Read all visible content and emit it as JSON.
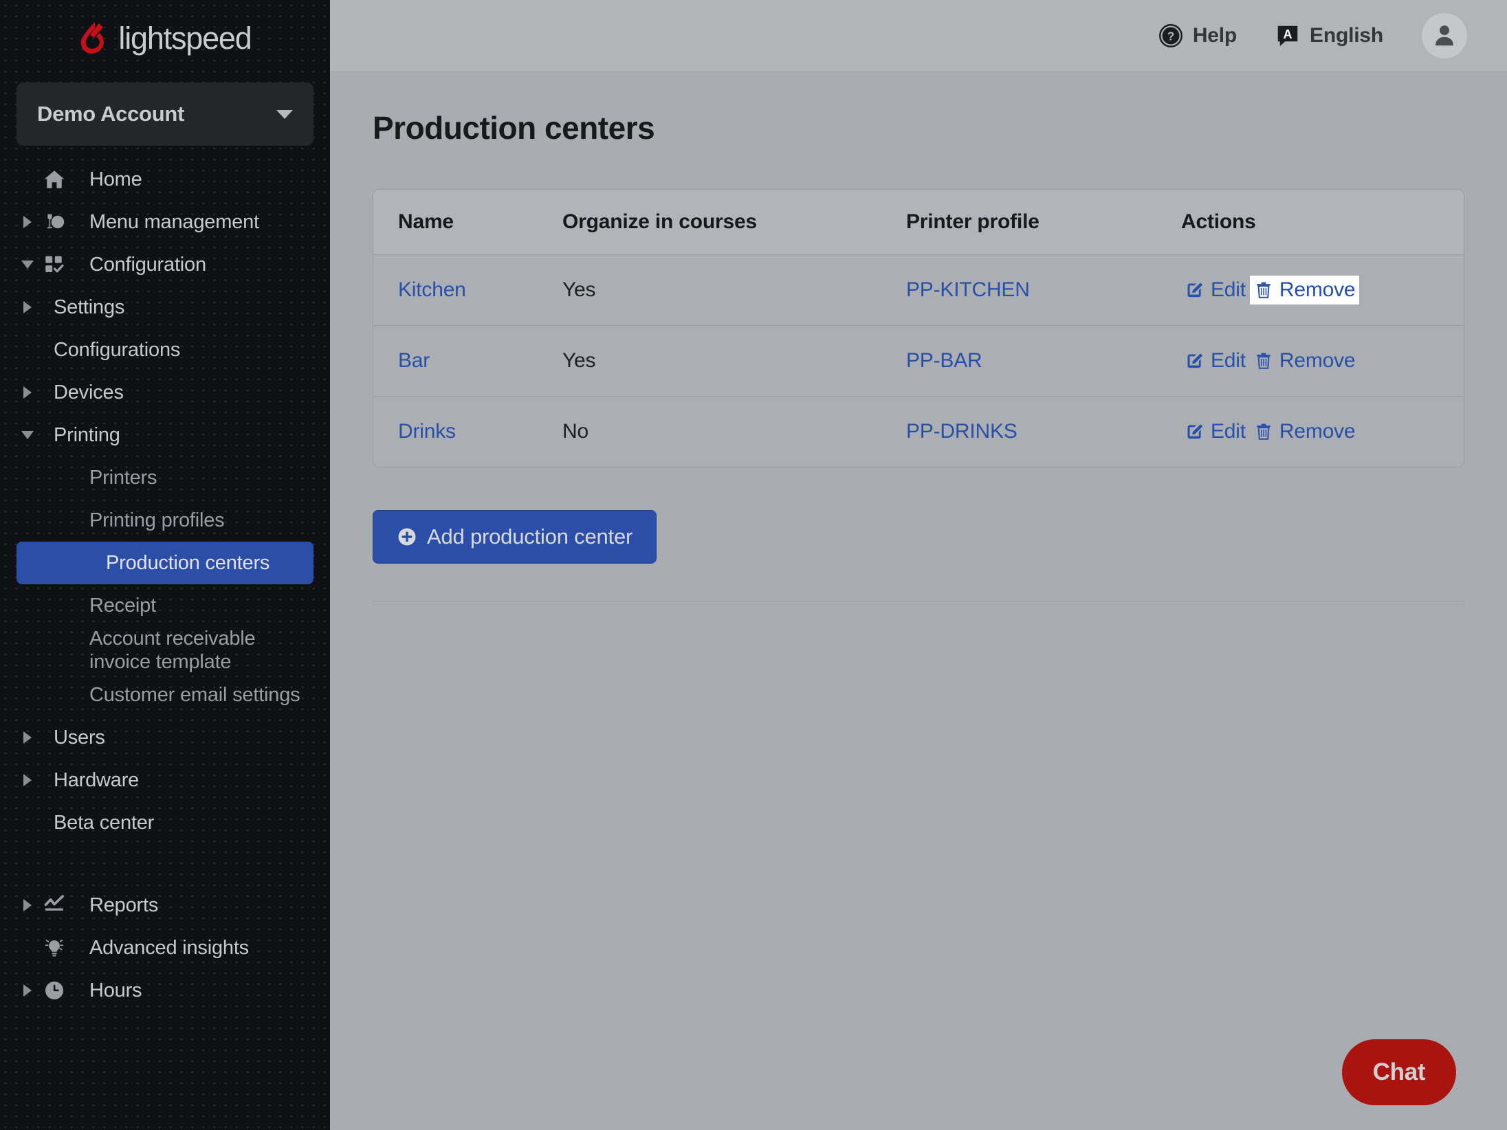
{
  "brand": {
    "name": "lightspeed",
    "logo_color": "#c3101a",
    "accent_blue": "#2b4fa8",
    "link_blue": "#2850a7",
    "chat_red": "#aa1410"
  },
  "sidebar": {
    "account": {
      "label": "Demo Account",
      "caret": "chevron-down-icon"
    },
    "items": [
      {
        "label": "Home",
        "level": 1,
        "icon": "home-icon",
        "arrow": "none",
        "active": false,
        "dim": false
      },
      {
        "label": "Menu management",
        "level": 1,
        "icon": "menu-mgmt-icon",
        "arrow": "right",
        "active": false,
        "dim": false
      },
      {
        "label": "Configuration",
        "level": 1,
        "icon": "config-icon",
        "arrow": "open",
        "active": false,
        "dim": false
      },
      {
        "label": "Settings",
        "level": 2,
        "icon": "none",
        "arrow": "right",
        "active": false,
        "dim": false
      },
      {
        "label": "Configurations",
        "level": 2,
        "icon": "none",
        "arrow": "none",
        "active": false,
        "dim": false
      },
      {
        "label": "Devices",
        "level": 2,
        "icon": "none",
        "arrow": "right",
        "active": false,
        "dim": false
      },
      {
        "label": "Printing",
        "level": 2,
        "icon": "none",
        "arrow": "open",
        "active": false,
        "dim": false
      },
      {
        "label": "Printers",
        "level": 3,
        "icon": "none",
        "arrow": "none",
        "active": false,
        "dim": true
      },
      {
        "label": "Printing profiles",
        "level": 3,
        "icon": "none",
        "arrow": "none",
        "active": false,
        "dim": true
      },
      {
        "label": "Production centers",
        "level": 3,
        "icon": "none",
        "arrow": "none",
        "active": true,
        "dim": false
      },
      {
        "label": "Receipt",
        "level": 3,
        "icon": "none",
        "arrow": "none",
        "active": false,
        "dim": true
      },
      {
        "label": "Account receivable invoice template",
        "level": 3,
        "icon": "none",
        "arrow": "none",
        "active": false,
        "dim": true
      },
      {
        "label": "Customer email settings",
        "level": 3,
        "icon": "none",
        "arrow": "none",
        "active": false,
        "dim": true
      },
      {
        "label": "Users",
        "level": 2,
        "icon": "none",
        "arrow": "right",
        "active": false,
        "dim": false
      },
      {
        "label": "Hardware",
        "level": 2,
        "icon": "none",
        "arrow": "right",
        "active": false,
        "dim": false
      },
      {
        "label": "Beta center",
        "level": 2,
        "icon": "none",
        "arrow": "none",
        "active": false,
        "dim": false
      }
    ],
    "items_bottom": [
      {
        "label": "Reports",
        "level": 1,
        "icon": "reports-icon",
        "arrow": "right",
        "active": false,
        "dim": false
      },
      {
        "label": "Advanced insights",
        "level": 1,
        "icon": "lightbulb-icon",
        "arrow": "none",
        "active": false,
        "dim": false
      },
      {
        "label": "Hours",
        "level": 1,
        "icon": "clock-icon",
        "arrow": "right",
        "active": false,
        "dim": false
      }
    ]
  },
  "topbar": {
    "help_label": "Help",
    "help_icon": "question-circle-icon",
    "language_label": "English",
    "language_icon": "translate-icon",
    "avatar_icon": "user-avatar-icon"
  },
  "main": {
    "page_title": "Production centers",
    "table": {
      "headers": [
        "Name",
        "Organize in courses",
        "Printer profile",
        "Actions"
      ],
      "rows": [
        {
          "name": "Kitchen",
          "organize": "Yes",
          "profile": "PP-KITCHEN",
          "edit_label": "Edit",
          "remove_label": "Remove",
          "remove_highlighted": true
        },
        {
          "name": "Bar",
          "organize": "Yes",
          "profile": "PP-BAR",
          "edit_label": "Edit",
          "remove_label": "Remove",
          "remove_highlighted": false
        },
        {
          "name": "Drinks",
          "organize": "No",
          "profile": "PP-DRINKS",
          "edit_label": "Edit",
          "remove_label": "Remove",
          "remove_highlighted": false
        }
      ]
    },
    "add_button": {
      "label": "Add production center",
      "icon": "plus-circle-icon"
    }
  },
  "chat": {
    "label": "Chat"
  }
}
